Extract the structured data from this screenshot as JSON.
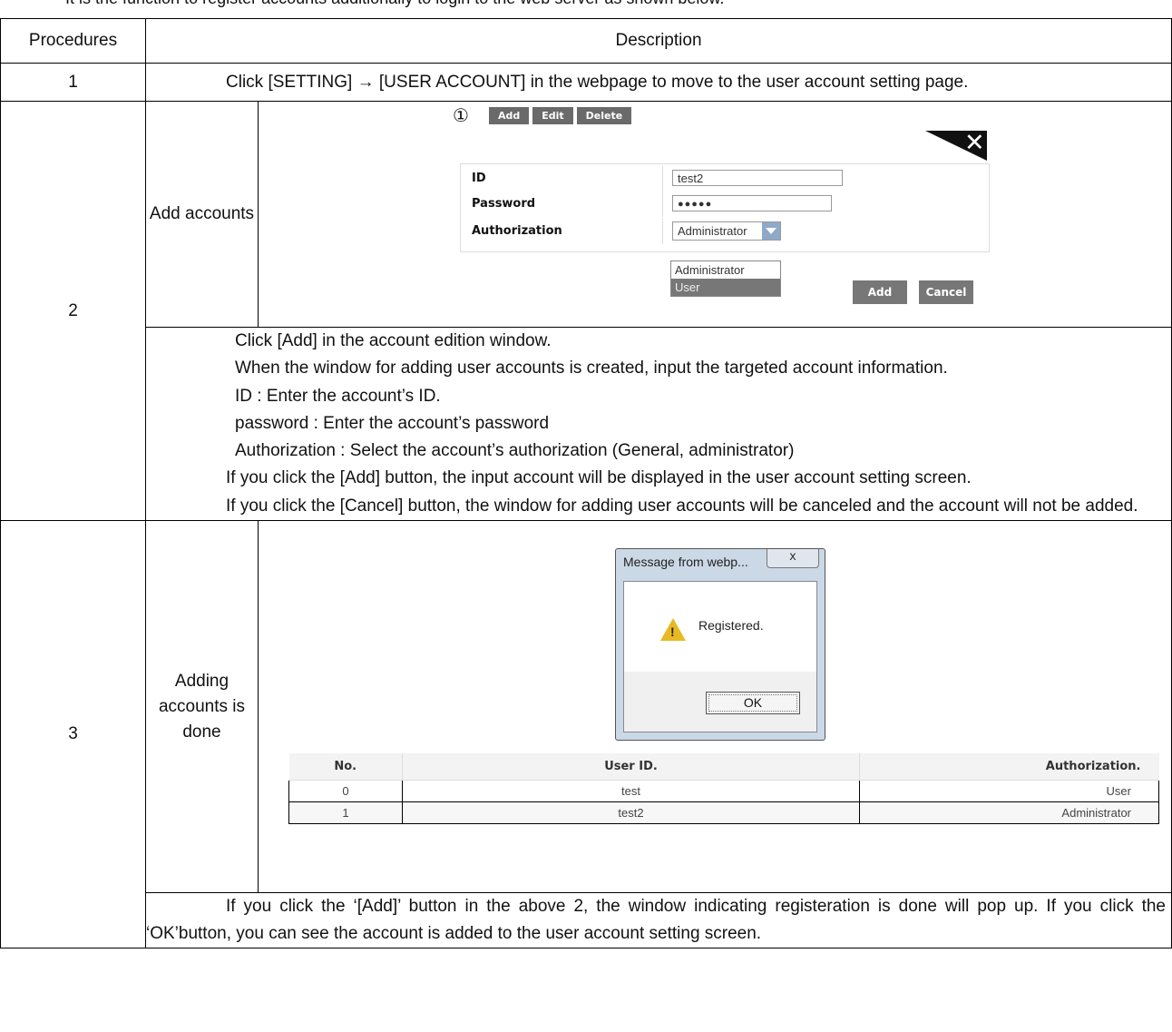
{
  "intro": "It is the function to register accounts additionally to login to the web server as shown below.",
  "table": {
    "headers": [
      "Procedures",
      "Description"
    ],
    "step1": {
      "num": "1",
      "text": "Click [SETTING] → [USER ACCOUNT] in the webpage to move to the user account setting page."
    },
    "step2": {
      "num": "2",
      "label": "Add accounts",
      "lines": [
        "Click [Add] in the account edition window.",
        "When the window for adding user accounts is created, input the targeted account information.",
        "ID : Enter the account’s ID.",
        "password : Enter the account’s password",
        "Authorization : Select the account’s authorization (General, administrator)",
        "If you click the [Add] button, the input account will be displayed in the user account setting screen.",
        "If you click the [Cancel] button, the window for adding user accounts will be canceled and the account will not be added."
      ]
    },
    "step3": {
      "num": "3",
      "label": "Adding accounts is done",
      "text": "If you click the ‘[Add]’ button in the above 2, the window indicating registeration is done will pop up. If you click the ‘OK’button, you can see the account is added to the user account setting screen."
    }
  },
  "screen_add": {
    "marker": "①",
    "toolbar": [
      "Add",
      "Edit",
      "Delete"
    ],
    "close_glyph": "✕",
    "fields": {
      "id_label": "ID",
      "id_value": "test2",
      "password_label": "Password",
      "password_value": "●●●●●",
      "auth_label": "Authorization",
      "auth_value": "Administrator"
    },
    "options": [
      "Administrator",
      "User"
    ],
    "add_label": "Add",
    "cancel_label": "Cancel"
  },
  "dialog": {
    "title": "Message from webp...",
    "close": "x",
    "message": "Registered.",
    "ok": "OK"
  },
  "accounts": {
    "headers": [
      "No.",
      "User ID.",
      "Authorization."
    ],
    "rows": [
      {
        "no": "0",
        "id": "test",
        "auth": "User"
      },
      {
        "no": "1",
        "id": "test2",
        "auth": "Administrator"
      }
    ]
  }
}
